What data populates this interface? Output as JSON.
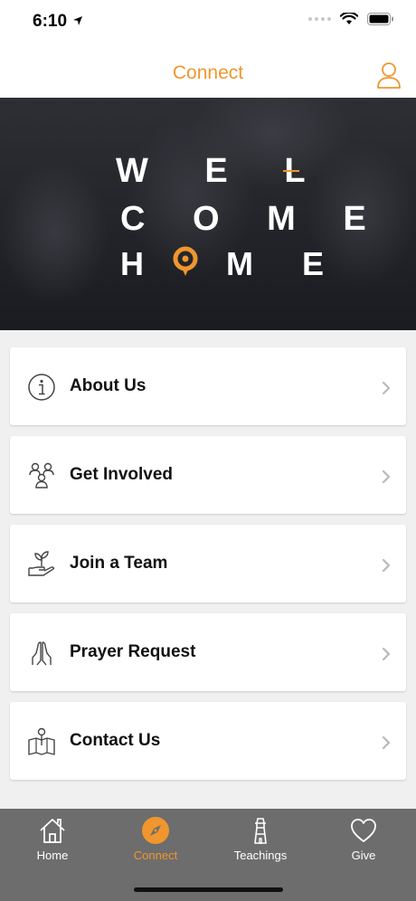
{
  "status": {
    "time": "6:10"
  },
  "header": {
    "title": "Connect"
  },
  "hero": {
    "row1": "W E L",
    "row2": "C O M E",
    "row3_h": "H",
    "row3_me": "M E"
  },
  "menu": {
    "items": [
      {
        "label": "About Us",
        "icon": "info-icon"
      },
      {
        "label": "Get Involved",
        "icon": "people-group-icon"
      },
      {
        "label": "Join a Team",
        "icon": "hand-plant-icon"
      },
      {
        "label": "Prayer Request",
        "icon": "praying-hands-icon"
      },
      {
        "label": "Contact Us",
        "icon": "map-pin-icon"
      }
    ]
  },
  "tabs": {
    "items": [
      {
        "label": "Home",
        "icon": "home-icon"
      },
      {
        "label": "Connect",
        "icon": "compass-icon"
      },
      {
        "label": "Teachings",
        "icon": "lighthouse-icon"
      },
      {
        "label": "Give",
        "icon": "heart-icon"
      }
    ],
    "active_color": "#f0962e"
  },
  "colors": {
    "accent": "#f0962e",
    "tab_bar": "#6d6d6d"
  }
}
